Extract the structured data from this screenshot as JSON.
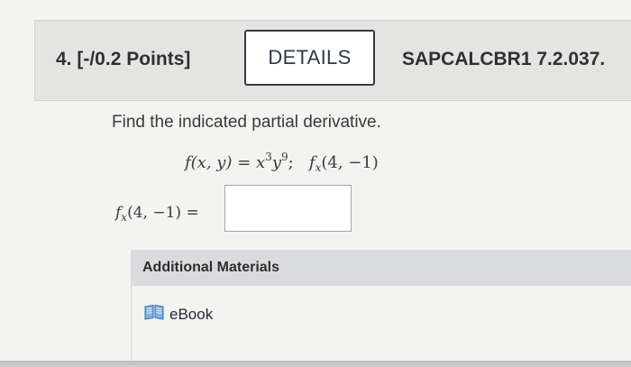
{
  "question": {
    "number": "4.",
    "points": "[-/0.2 Points]",
    "details_label": "DETAILS",
    "reference": "SAPCALCBR1 7.2.037."
  },
  "problem": {
    "prompt": "Find the indicated partial derivative.",
    "function_lhs": "f(x, y)",
    "equals": "=",
    "x": "x",
    "x_exp": "3",
    "y": "y",
    "y_exp": "9",
    "separator": ";",
    "target_f": "f",
    "target_sub": "x",
    "target_args": "(4, −1)"
  },
  "answer": {
    "label_f": "f",
    "label_sub": "x",
    "label_args": "(4, −1)",
    "label_eq": "=",
    "value": ""
  },
  "additional": {
    "title": "Additional Materials",
    "ebook_label": "eBook",
    "icon": "book-icon"
  },
  "colors": {
    "header_bg": "#e4e4e2",
    "page_bg": "#f3f3f1",
    "materials_bar": "#dadbde",
    "button_border": "#333a44",
    "book_icon": "#6aa0d6"
  }
}
